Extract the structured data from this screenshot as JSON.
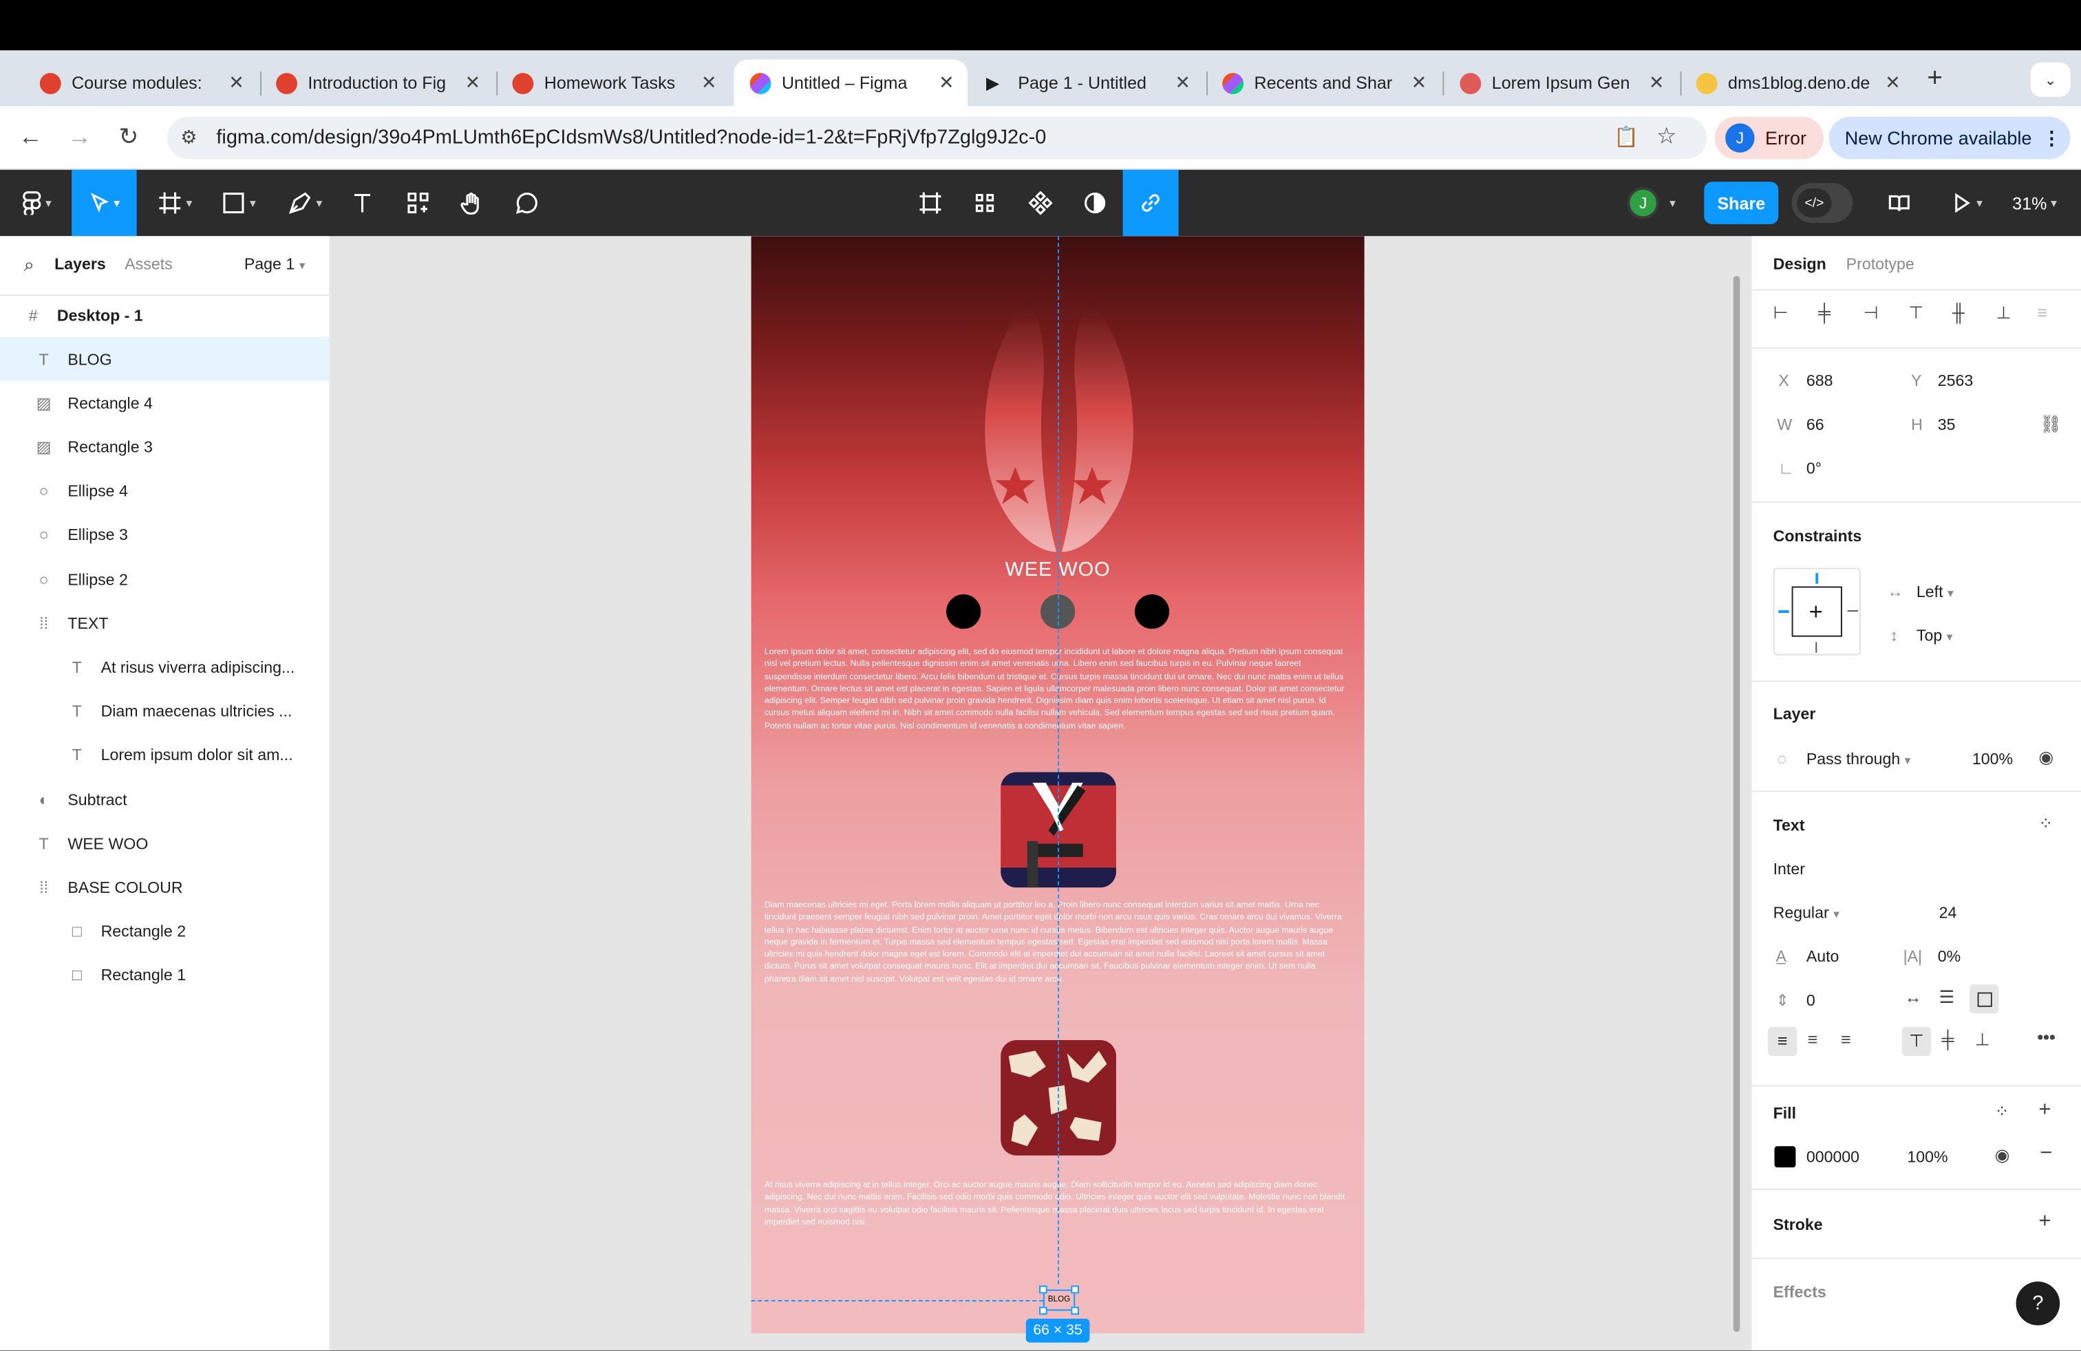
{
  "browser": {
    "tabs": [
      {
        "title": "Course modules: ",
        "favicon_color": "#e0402e"
      },
      {
        "title": "Introduction to Fig",
        "favicon_color": "#e0402e"
      },
      {
        "title": "Homework Tasks",
        "favicon_color": "#e0402e"
      },
      {
        "title": "Untitled – Figma",
        "favicon_color": "#f24e1e",
        "active": true
      },
      {
        "title": "Page 1 - Untitled",
        "favicon_color": "#1e1e1e"
      },
      {
        "title": "Recents and Shar",
        "favicon_color": "#a259ff"
      },
      {
        "title": "Lorem Ipsum Gen",
        "favicon_color": "#e05a5a"
      },
      {
        "title": "dms1blog.deno.de",
        "favicon_color": "#f5c542"
      }
    ],
    "url": "figma.com/design/39o4PmLUmth6EpCIdsmWs8/Untitled?node-id=1-2&t=FpRjVfp7Zglg9J2c-0",
    "profile_initial": "J",
    "error_label": "Error",
    "update_label": "New Chrome available"
  },
  "toolbar": {
    "share_label": "Share",
    "zoom": "31%",
    "user_initial": "J"
  },
  "left_panel": {
    "tabs": [
      "Layers",
      "Assets"
    ],
    "page": "Page 1",
    "frame_name": "Desktop - 1",
    "layers": [
      {
        "name": "BLOG",
        "icon": "text-icon",
        "indent": 0,
        "selected": true
      },
      {
        "name": "Rectangle 4",
        "icon": "image-icon",
        "indent": 0
      },
      {
        "name": "Rectangle 3",
        "icon": "image-icon",
        "indent": 0
      },
      {
        "name": "Ellipse 4",
        "icon": "ellipse-icon",
        "indent": 0
      },
      {
        "name": "Ellipse 3",
        "icon": "ellipse-icon",
        "indent": 0
      },
      {
        "name": "Ellipse 2",
        "icon": "ellipse-icon",
        "indent": 0
      },
      {
        "name": "TEXT",
        "icon": "group-icon",
        "indent": 0
      },
      {
        "name": "At risus viverra adipiscing...",
        "icon": "text-icon",
        "indent": 1
      },
      {
        "name": "Diam maecenas ultricies ...",
        "icon": "text-icon",
        "indent": 1
      },
      {
        "name": "Lorem ipsum dolor sit am...",
        "icon": "text-icon",
        "indent": 1
      },
      {
        "name": "Subtract",
        "icon": "boolean-icon",
        "indent": 0
      },
      {
        "name": "WEE WOO",
        "icon": "text-icon",
        "indent": 0
      },
      {
        "name": "BASE COLOUR",
        "icon": "group-icon",
        "indent": 0
      },
      {
        "name": "Rectangle 2",
        "icon": "rectangle-icon",
        "indent": 1
      },
      {
        "name": "Rectangle 1",
        "icon": "rectangle-icon",
        "indent": 1
      }
    ]
  },
  "canvas": {
    "heading": "WEE WOO",
    "paragraph_1": "Lorem ipsum dolor sit amet, consectetur adipiscing elit, sed do eiusmod tempor incididunt ut labore et dolore magna aliqua. Pretium nibh ipsum consequat nisl vel pretium lectus. Nulla pellentesque dignissim enim sit amet venenatis urna. Libero enim sed faucibus turpis in eu. Pulvinar neque laoreet suspendisse interdum consectetur libero. Arcu felis bibendum ut tristique et. Cursus turpis massa tincidunt dui ut ornare. Nec dui nunc mattis enim ut tellus elementum. Ornare lectus sit amet est placerat in egestas. Sapien et ligula ullamcorper malesuada proin libero nunc consequat. Dolor sit amet consectetur adipiscing elit. Semper feugiat nibh sed pulvinar proin gravida hendrerit. Dignissim diam quis enim lobortis scelerisque. Ut etiam sit amet nisl purus. Id cursus metus aliquam eleifend mi in. Nibh sit amet commodo nulla facilisi nullam vehicula. Sed elementum tempus egestas sed sed risus pretium quam. Potenti nullam ac tortor vitae purus. Nisl condimentum id venenatis a condimentum vitae sapien.",
    "paragraph_2": "Diam maecenas ultricies mi eget. Porta lorem mollis aliquam ut porttitor leo a. Proin libero nunc consequat interdum varius sit amet mattis. Urna nec tincidunt praesent semper feugiat nibh sed pulvinar proin. Amet porttitor eget dolor morbi non arcu risus quis varius. Cras ornare arcu dui vivamus. Viverra tellus in hac habitasse platea dictumst. Enim tortor at auctor urna nunc id cursus metus. Bibendum est ultricies integer quis. Auctor augue mauris augue neque gravida in fermentum et. Turpis massa sed elementum tempus egestas sed. Egestas erat imperdiet sed euismod nisi porta lorem mollis. Massa ultricies mi quis hendrerit dolor magna eget est lorem. Commodo elit at imperdiet dui accumsan sit amet nulla facilisi. Laoreet sit amet cursus sit amet dictum. Purus sit amet volutpat consequat mauris nunc. Elit at imperdiet dui accumsan sit. Faucibus pulvinar elementum integer enim. Ut sem nulla pharetra diam sit amet nisl suscipit. Volutpat est velit egestas dui id ornare arcu.",
    "paragraph_3": "At risus viverra adipiscing at in tellus integer. Orci ac auctor augue mauris augue. Diam sollicitudin tempor id eu. Aenean sed adipiscing diam donec adipiscing. Nec dui nunc mattis enim. Facilisis sed odio morbi quis commodo odio. Ultricies integer quis auctor elit sed vulputate. Molestie nunc non blandit massa. Viverra orci sagittis eu volutpat odio facilisis mauris sit. Pellentesque massa placerat duis ultricies lacus sed turpis tincidunt id. In egestas erat imperdiet sed euismod nisi.",
    "selected_text": "BLOG",
    "selection_size": "66 × 35"
  },
  "right_panel": {
    "tabs": [
      "Design",
      "Prototype"
    ],
    "x_label": "X",
    "x": "688",
    "y_label": "Y",
    "y": "2563",
    "w_label": "W",
    "w": "66",
    "h_label": "H",
    "h": "35",
    "rotation": "0°",
    "constraints_title": "Constraints",
    "constraint_h": "Left",
    "constraint_v": "Top",
    "layer_title": "Layer",
    "blend": "Pass through",
    "opacity": "100%",
    "text_title": "Text",
    "font": "Inter",
    "weight": "Regular",
    "size": "24",
    "line_height": "Auto",
    "letter_spacing": "0%",
    "paragraph_spacing": "0",
    "fill_title": "Fill",
    "fill_hex": "000000",
    "fill_opacity": "100%",
    "stroke_title": "Stroke",
    "effects_title": "Effects",
    "help": "?"
  }
}
